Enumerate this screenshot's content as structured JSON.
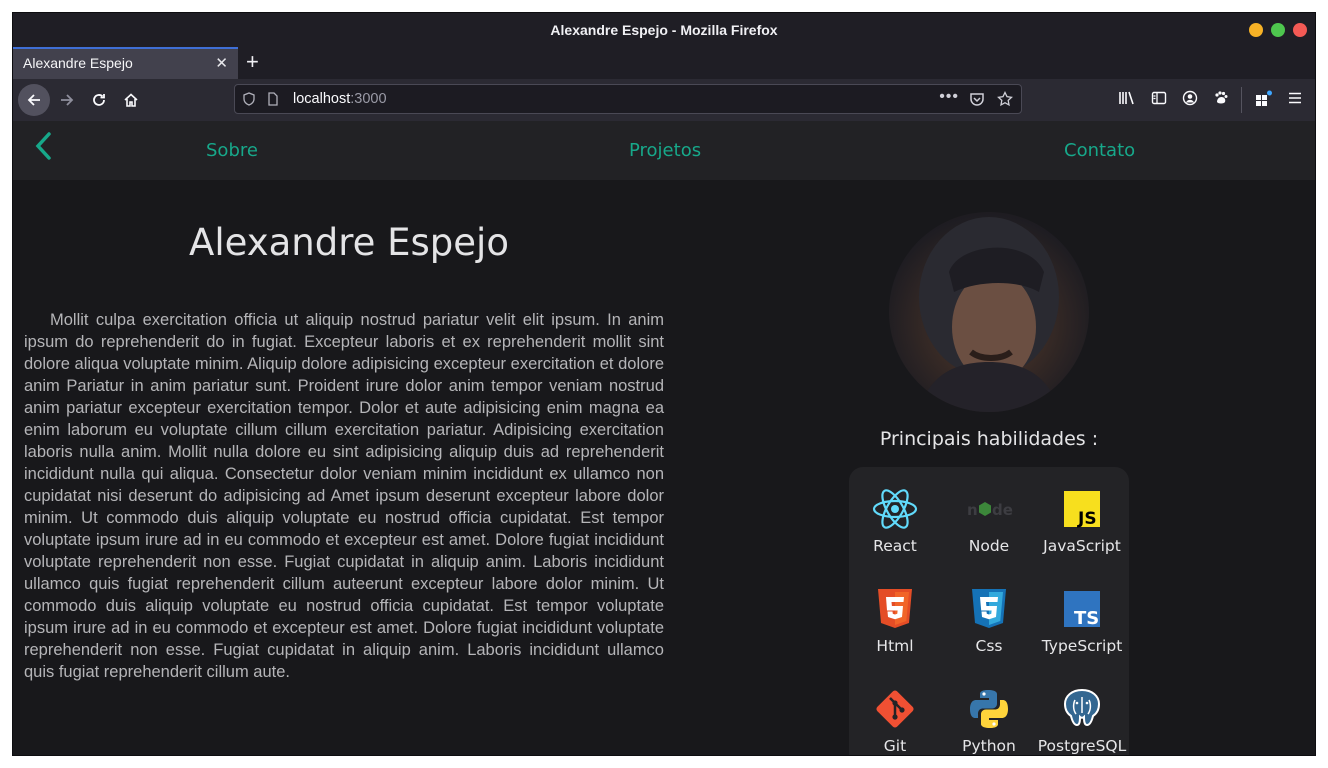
{
  "browser": {
    "window_title": "Alexandre Espejo - Mozilla Firefox",
    "tab_title": "Alexandre Espejo",
    "tab_close": "✕",
    "new_tab": "+",
    "url_host": "localhost",
    "url_port": ":3000",
    "url_more": "•••"
  },
  "site": {
    "nav": {
      "back": "‹",
      "links": [
        "Sobre",
        "Projetos",
        "Contato"
      ]
    },
    "name": "Alexandre Espejo",
    "bio": "Mollit culpa exercitation officia ut aliquip nostrud pariatur velit elit ipsum. In anim ipsum do reprehenderit do in fugiat. Excepteur laboris et ex reprehenderit mollit sint dolore aliqua voluptate minim. Aliquip dolore adipisicing excepteur exercitation et dolore anim Pariatur in anim pariatur sunt. Proident irure dolor anim tempor veniam nostrud anim pariatur excepteur exercitation tempor. Dolor et aute adipisicing enim magna ea enim laborum eu voluptate cillum cillum exercitation pariatur. Adipisicing exercitation laboris nulla anim. Mollit nulla dolore eu sint adipisicing aliquip duis ad reprehenderit incididunt nulla qui aliqua. Consectetur dolor veniam minim incididunt ex ullamco non cupidatat nisi deserunt do adipisicing ad Amet ipsum deserunt excepteur labore dolor minim. Ut commodo duis aliquip voluptate eu nostrud officia cupidatat. Est tempor voluptate ipsum irure ad in eu commodo et excepteur est amet. Dolore fugiat incididunt voluptate reprehenderit non esse. Fugiat cupidatat in aliquip anim. Laboris incididunt ullamco quis fugiat reprehenderit cillum auteerunt excepteur labore dolor minim. Ut commodo duis aliquip voluptate eu nostrud officia cupidatat. Est tempor voluptate ipsum irure ad in eu commodo et excepteur est amet. Dolore fugiat incididunt voluptate reprehenderit non esse. Fugiat cupidatat in aliquip anim. Laboris incididunt ullamco quis fugiat reprehenderit cillum aute.",
    "skills_title": "Principais habilidades :",
    "skills": [
      {
        "label": "React",
        "icon": "react-icon"
      },
      {
        "label": "Node",
        "icon": "node-icon"
      },
      {
        "label": "JavaScript",
        "icon": "javascript-icon"
      },
      {
        "label": "Html",
        "icon": "html5-icon"
      },
      {
        "label": "Css",
        "icon": "css3-icon"
      },
      {
        "label": "TypeScript",
        "icon": "typescript-icon"
      },
      {
        "label": "Git",
        "icon": "git-icon"
      },
      {
        "label": "Python",
        "icon": "python-icon"
      },
      {
        "label": "PostgreSQL",
        "icon": "postgresql-icon"
      }
    ],
    "accent_color": "#17a88a"
  }
}
